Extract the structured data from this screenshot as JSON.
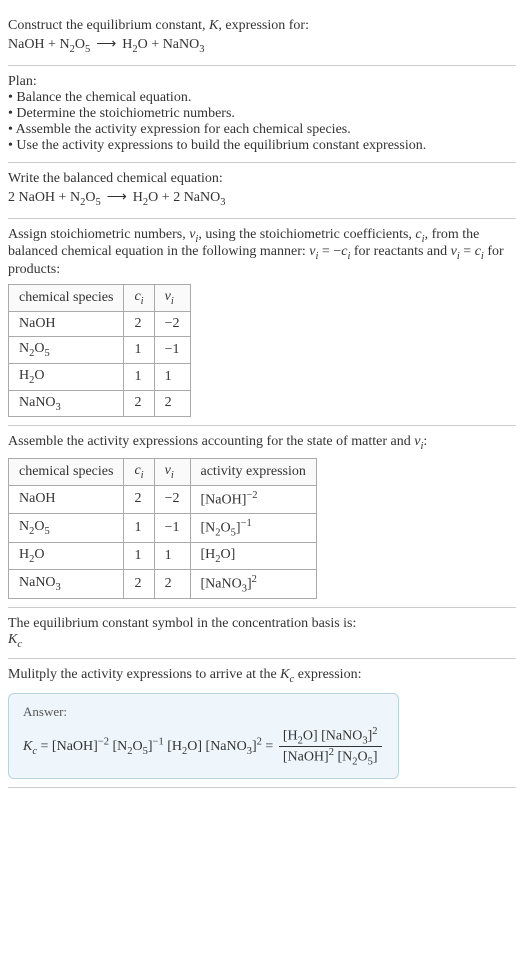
{
  "intro": {
    "line1_prefix": "Construct the equilibrium constant, ",
    "line1_K": "K",
    "line1_suffix": ", expression for:",
    "reaction_lhs1": "NaOH",
    "plus": " + ",
    "reaction_lhs2_a": "N",
    "reaction_lhs2_b": "2",
    "reaction_lhs2_c": "O",
    "reaction_lhs2_d": "5",
    "arrow": "⟶",
    "reaction_rhs1_a": "H",
    "reaction_rhs1_b": "2",
    "reaction_rhs1_c": "O",
    "reaction_rhs2_a": "NaNO",
    "reaction_rhs2_b": "3"
  },
  "plan": {
    "title": "Plan:",
    "b1": "• Balance the chemical equation.",
    "b2": "• Determine the stoichiometric numbers.",
    "b3": "• Assemble the activity expression for each chemical species.",
    "b4": "• Use the activity expressions to build the equilibrium constant expression."
  },
  "balanced": {
    "title": "Write the balanced chemical equation:",
    "c1": "2 NaOH",
    "c2a": "N",
    "c2b": "2",
    "c2c": "O",
    "c2d": "5",
    "c3a": "H",
    "c3b": "2",
    "c3c": "O",
    "c4a": "2 NaNO",
    "c4b": "3"
  },
  "assign": {
    "text_a": "Assign stoichiometric numbers, ",
    "nu_i": "ν",
    "sub_i": "i",
    "text_b": ", using the stoichiometric coefficients, ",
    "c_i": "c",
    "text_c": ", from the balanced chemical equation in the following manner: ",
    "eq1": "ν",
    "eq1b": " = −",
    "eq1c": "c",
    "text_d": " for reactants and ",
    "eq1d": " = ",
    "text_e": " for products:",
    "hdr1": "chemical species",
    "hdr2": "c",
    "hdr3": "ν",
    "rows": [
      {
        "s": "NaOH",
        "c": "2",
        "v": "−2"
      },
      {
        "s_a": "N",
        "s_b": "2",
        "s_c": "O",
        "s_d": "5",
        "c": "1",
        "v": "−1"
      },
      {
        "s_a": "H",
        "s_b": "2",
        "s_c": "O",
        "c": "1",
        "v": "1"
      },
      {
        "s_a": "NaNO",
        "s_b": "3",
        "c": "2",
        "v": "2"
      }
    ]
  },
  "activity": {
    "title_a": "Assemble the activity expressions accounting for the state of matter and ",
    "title_nu": "ν",
    "title_i": "i",
    "title_b": ":",
    "hdr4": "activity expression",
    "rows": [
      {
        "sp": "NaOH",
        "c": "2",
        "v": "−2",
        "ae_a": "[NaOH]",
        "ae_exp": "−2"
      },
      {
        "sp_a": "N",
        "sp_b": "2",
        "sp_c": "O",
        "sp_d": "5",
        "c": "1",
        "v": "−1",
        "ae_a": "[N",
        "ae_b": "2",
        "ae_c": "O",
        "ae_d": "5",
        "ae_e": "]",
        "ae_exp": "−1"
      },
      {
        "sp_a": "H",
        "sp_b": "2",
        "sp_c": "O",
        "c": "1",
        "v": "1",
        "ae_a": "[H",
        "ae_b": "2",
        "ae_c": "O]"
      },
      {
        "sp_a": "NaNO",
        "sp_b": "3",
        "c": "2",
        "v": "2",
        "ae_a": "[NaNO",
        "ae_b": "3",
        "ae_c": "]",
        "ae_exp": "2"
      }
    ]
  },
  "symbol": {
    "text": "The equilibrium constant symbol in the concentration basis is:",
    "K": "K",
    "c": "c"
  },
  "multiply": {
    "text_a": "Mulitply the activity expressions to arrive at the ",
    "K": "K",
    "c": "c",
    "text_b": " expression:"
  },
  "answer": {
    "label": "Answer:",
    "Kc_K": "K",
    "Kc_c": "c",
    "eq": " = ",
    "t1": "[NaOH]",
    "e1": "−2",
    "sp": " ",
    "t2a": "[N",
    "t2b": "2",
    "t2c": "O",
    "t2d": "5",
    "t2e": "]",
    "e2": "−1",
    "t3a": "[H",
    "t3b": "2",
    "t3c": "O]",
    "t4a": "[NaNO",
    "t4b": "3",
    "t4c": "]",
    "e4": "2",
    "eq2": " = ",
    "num_a": "[H",
    "num_b": "2",
    "num_c": "O] [NaNO",
    "num_d": "3",
    "num_e": "]",
    "num_exp": "2",
    "den_a": "[NaOH]",
    "den_exp1": "2",
    "den_b": " [N",
    "den_c": "2",
    "den_d": "O",
    "den_e": "5",
    "den_f": "]"
  }
}
